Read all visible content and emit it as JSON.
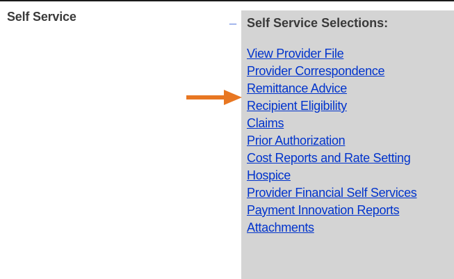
{
  "self_service": {
    "title": "Self Service",
    "toggle_label": "_"
  },
  "selections": {
    "title": "Self Service Selections:",
    "links": [
      {
        "label": "View Provider File"
      },
      {
        "label": "Provider Correspondence"
      },
      {
        "label": "Remittance Advice"
      },
      {
        "label": "Recipient Eligibility"
      },
      {
        "label": "Claims"
      },
      {
        "label": "Prior Authorization"
      },
      {
        "label": "Cost Reports and Rate Setting"
      },
      {
        "label": "Hospice"
      },
      {
        "label": "Provider Financial Self Services"
      },
      {
        "label": "Payment Innovation Reports"
      },
      {
        "label": "Attachments"
      }
    ]
  },
  "annotation": {
    "arrow_color": "#e87722",
    "arrow_icon": "arrow-right-icon",
    "points_to": "Remittance Advice"
  },
  "colors": {
    "link": "#0033cc",
    "panel_background": "#d4d4d4",
    "heading_text": "#3a3a3a"
  }
}
